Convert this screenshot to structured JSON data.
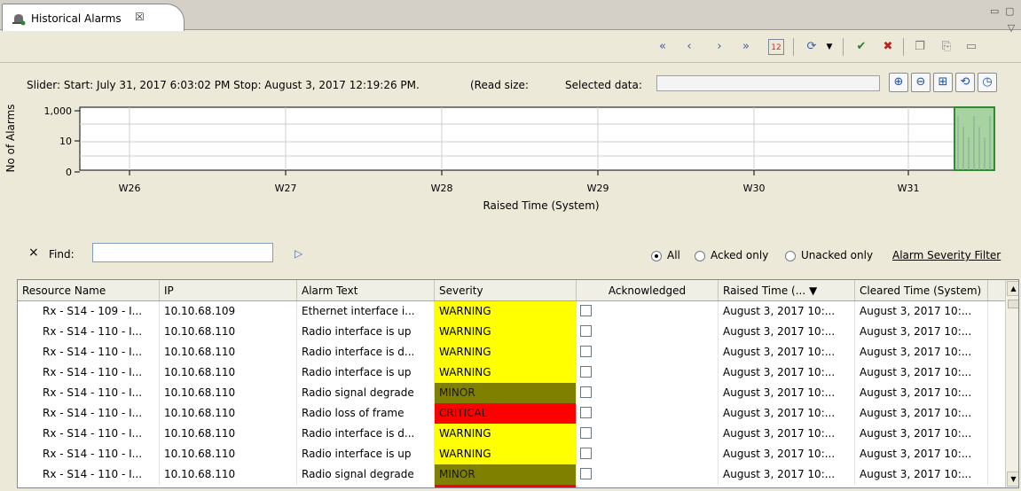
{
  "tab": {
    "title": "Historical Alarms",
    "close": "☒"
  },
  "window_controls": {
    "minimize": "▭",
    "maximize": "▢",
    "menu": "▽"
  },
  "toolbar": {
    "icons": [
      "prev-prev-icon",
      "back-icon",
      "forward-icon",
      "next-next-icon",
      "calendar-icon",
      "refresh-dropdown-icon",
      "ack-icon",
      "unack-icon",
      "copy-icon",
      "export-icon",
      "comment-icon"
    ]
  },
  "slider": {
    "text": "Slider: Start: July 31, 2017 6:03:02 PM  Stop: August 3, 2017 12:19:26 PM.",
    "read_size": "(Read size:",
    "selected_label": "Selected data:"
  },
  "chart_data": {
    "type": "bar",
    "ylabel": "No of Alarms",
    "xlabel": "Raised Time (System)",
    "y_scale": "log",
    "y_ticks": [
      "1,000",
      "10",
      "0"
    ],
    "categories": [
      "W26",
      "W27",
      "W28",
      "W29",
      "W30",
      "W31"
    ],
    "selected_range": [
      "W31",
      "end"
    ]
  },
  "find": {
    "close": "×",
    "label": "Find:",
    "value": "",
    "go": "▷"
  },
  "filter": {
    "all": "All",
    "acked": "Acked only",
    "unacked": "Unacked only",
    "severity_link": "Alarm Severity Filter",
    "selected": "all"
  },
  "table": {
    "columns": [
      "Resource Name",
      "IP",
      "Alarm Text",
      "Severity",
      "Acknowledged",
      "Raised Time (...",
      "Cleared Time (System)"
    ],
    "rows": [
      [
        "Rx - S14 - 109 - I...",
        "10.10.68.109",
        "Ethernet interface i...",
        "WARNING",
        "",
        "August 3, 2017 10:...",
        "August 3, 2017 10:..."
      ],
      [
        "Rx - S14 - 110 - I...",
        "10.10.68.110",
        "Radio interface is up",
        "WARNING",
        "",
        "August 3, 2017 10:...",
        "August 3, 2017 10:..."
      ],
      [
        "Rx - S14 - 110 - I...",
        "10.10.68.110",
        "Radio interface is d...",
        "WARNING",
        "",
        "August 3, 2017 10:...",
        "August 3, 2017 10:..."
      ],
      [
        "Rx - S14 - 110 - I...",
        "10.10.68.110",
        "Radio interface is up",
        "WARNING",
        "",
        "August 3, 2017 10:...",
        "August 3, 2017 10:..."
      ],
      [
        "Rx - S14 - 110 - I...",
        "10.10.68.110",
        "Radio signal degrade",
        "MINOR",
        "",
        "August 3, 2017 10:...",
        "August 3, 2017 10:..."
      ],
      [
        "Rx - S14 - 110 - I...",
        "10.10.68.110",
        "Radio loss of frame",
        "CRITICAL",
        "",
        "August 3, 2017 10:...",
        "August 3, 2017 10:..."
      ],
      [
        "Rx - S14 - 110 - I...",
        "10.10.68.110",
        "Radio interface is d...",
        "WARNING",
        "",
        "August 3, 2017 10:...",
        "August 3, 2017 10:..."
      ],
      [
        "Rx - S14 - 110 - I...",
        "10.10.68.110",
        "Radio interface is up",
        "WARNING",
        "",
        "August 3, 2017 10:...",
        "August 3, 2017 10:..."
      ],
      [
        "Rx - S14 - 110 - I...",
        "10.10.68.110",
        "Radio signal degrade",
        "MINOR",
        "",
        "August 3, 2017 10:...",
        "August 3, 2017 10:..."
      ]
    ]
  },
  "severity_colors": {
    "WARNING": "#ffff00",
    "MINOR": "#808000",
    "CRITICAL": "#ff0000"
  }
}
